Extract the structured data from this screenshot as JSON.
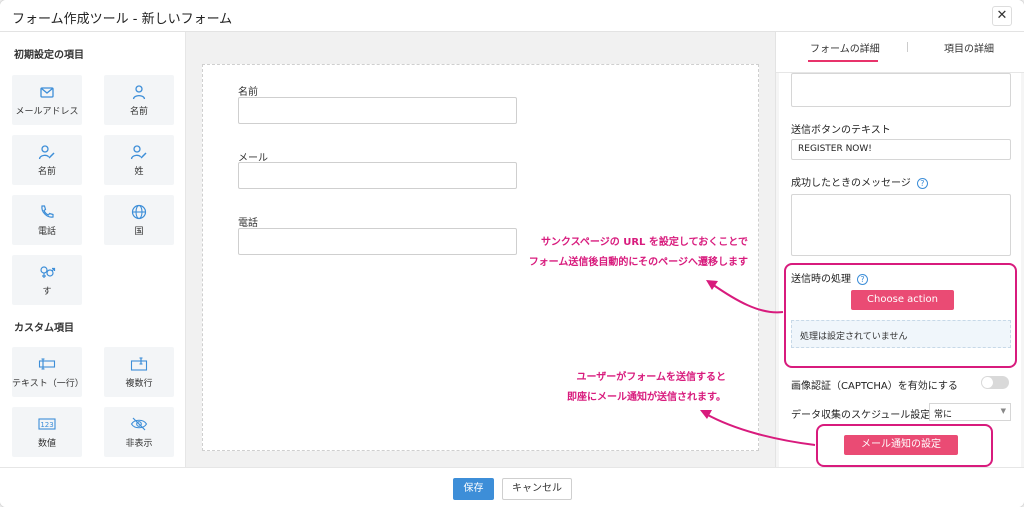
{
  "window": {
    "title": "フォーム作成ツール - 新しいフォーム",
    "close_label": "✕"
  },
  "left_panel": {
    "default_section_title": "初期設定の項目",
    "default_items": [
      {
        "label": "メールアドレス",
        "icon": "mail-icon"
      },
      {
        "label": "名前",
        "icon": "person-icon"
      },
      {
        "label": "名前",
        "icon": "person-edit-icon"
      },
      {
        "label": "姓",
        "icon": "person-edit-icon"
      },
      {
        "label": "電話",
        "icon": "phone-icon"
      },
      {
        "label": "国",
        "icon": "globe-icon"
      },
      {
        "label": "す",
        "icon": "gender-icon"
      }
    ],
    "custom_section_title": "カスタム項目",
    "custom_items": [
      {
        "label": "テキスト（一行）",
        "icon": "single-line-text-icon"
      },
      {
        "label": "複数行",
        "icon": "multi-line-text-icon"
      },
      {
        "label": "数値",
        "icon": "number-icon"
      },
      {
        "label": "非表示",
        "icon": "hidden-eye-icon"
      }
    ]
  },
  "form": {
    "fields": [
      {
        "label": "名前",
        "value": ""
      },
      {
        "label": "メール",
        "value": ""
      },
      {
        "label": "電話",
        "value": ""
      }
    ]
  },
  "right_panel": {
    "tabs": [
      {
        "label": "フォームの詳細",
        "active": true
      },
      {
        "label": "項目の詳細",
        "active": false
      }
    ],
    "submit_text_label": "送信ボタンのテキスト",
    "submit_text_value": "REGISTER NOW!",
    "success_message_label": "成功したときのメッセージ",
    "on_submit_label": "送信時の処理",
    "choose_action_label": "Choose action",
    "no_action_text": "処理は設定されていません",
    "captcha_label": "画像認証（CAPTCHA）を有効にする",
    "captcha_enabled": false,
    "schedule_label": "データ収集のスケジュール設定",
    "schedule_value": "常に",
    "email_notify_label": "メール通知の設定",
    "help_glyph": "?"
  },
  "footer": {
    "save_label": "保存",
    "cancel_label": "キャンセル"
  },
  "annotations": {
    "thankyou_line1": "サンクスページの URL を設定しておくことで",
    "thankyou_line2": "フォーム送信後自動的にそのページへ遷移します",
    "notify_line1": "ユーザーがフォームを送信すると",
    "notify_line2": "即座にメール通知が送信されます。"
  },
  "colors": {
    "accent_pink": "#ea4b74",
    "annotation_magenta": "#d81b7d",
    "primary_blue": "#3d8ed8",
    "icon_blue": "#3d8ed8"
  }
}
